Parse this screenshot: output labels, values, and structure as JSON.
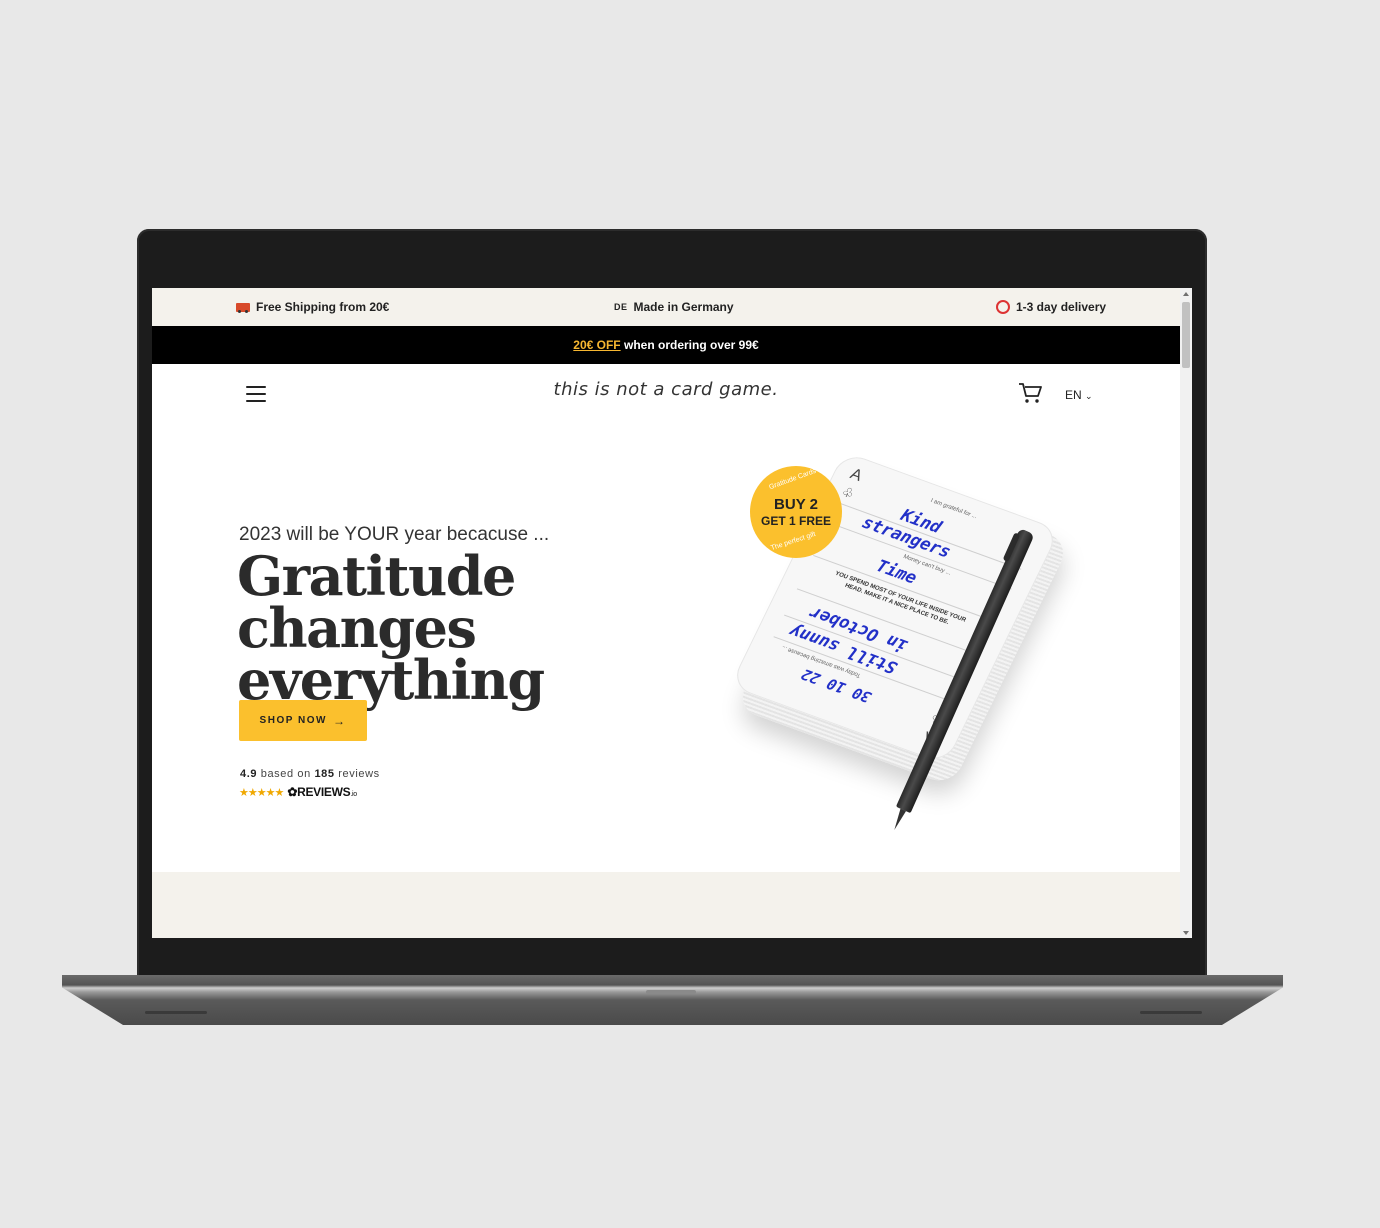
{
  "infobar": {
    "shipping": "Free Shipping from 20€",
    "made_flag": "DE",
    "made": "Made in Germany",
    "delivery": "1-3 day delivery"
  },
  "promo": {
    "off": "20€ OFF",
    "text": "when ordering over 99€"
  },
  "header": {
    "logo": "this is not a card game.",
    "language": "EN"
  },
  "hero": {
    "kicker": "2023 will be YOUR year becacuse ...",
    "headline": "Gratitude changes everything",
    "button": "SHOP NOW",
    "rating_score": "4.9",
    "rating_based_on": "based on",
    "rating_count": "185",
    "rating_reviews": "reviews",
    "stars": "★★★★★",
    "reviews_brand": "REVIEWS",
    "reviews_suffix": ".io"
  },
  "badge": {
    "arc_top": "Gratitude Cards",
    "line1": "BUY 2",
    "line2": "GET 1 FREE",
    "arc_bottom": "The perfect gift"
  },
  "card": {
    "prompt1": "I am grateful for ...",
    "answer1a": "Kind",
    "answer1b": "strangers",
    "prompt2": "Money can't buy ...",
    "answer2": "Time",
    "quote": "YOU SPEND MOST OF YOUR LIFE INSIDE YOUR HEAD. MAKE IT A NICE PLACE TO BE.",
    "answer3a": "Still sunny",
    "answer3b": "in October",
    "prompt3": "Today was amazing because ...",
    "date": "30 10 22",
    "ace": "A"
  }
}
